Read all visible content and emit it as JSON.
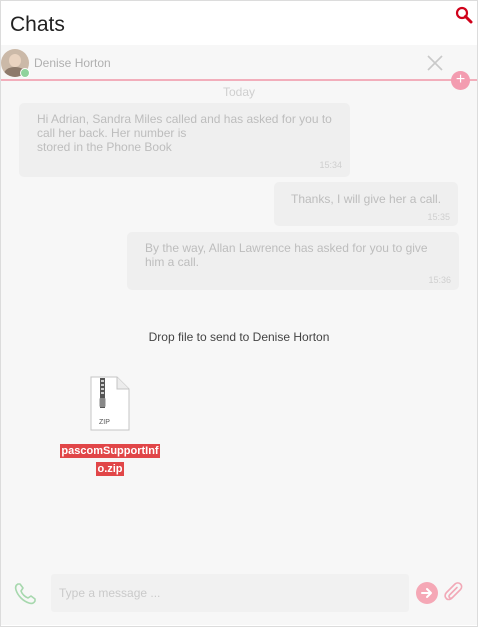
{
  "header": {
    "title": "Chats"
  },
  "conversation": {
    "contact_name": "Denise Horton",
    "day_separator": "Today",
    "messages": [
      {
        "text": "Hi Adrian, Sandra Miles called and has asked for you to call her back. Her number is\nstored in the Phone Book",
        "time": "15:34",
        "direction": "incoming"
      },
      {
        "text": "Thanks, I will give her a call.",
        "time": "15:35",
        "direction": "outgoing"
      },
      {
        "text": "By the way, Allan Lawrence has asked for you to give him a call.",
        "time": "15:36",
        "direction": "outgoing"
      }
    ]
  },
  "drop": {
    "label": "Drop file to send to Denise Horton",
    "file": {
      "type_label": "ZIP",
      "name_line1": "pascomSupportInf",
      "name_line2": "o.zip"
    }
  },
  "composer": {
    "placeholder": "Type a message ..."
  },
  "icons": {
    "search": "search-icon",
    "close": "close-icon",
    "add": "plus-icon",
    "phone": "phone-icon",
    "send": "send-arrow-icon",
    "attach": "paperclip-icon",
    "file": "zip-file-icon"
  },
  "colors": {
    "accent": "#e0245e",
    "presence": "#8fd39c",
    "file_label_bg": "#e14648",
    "phone_green": "#a7d8ae"
  }
}
